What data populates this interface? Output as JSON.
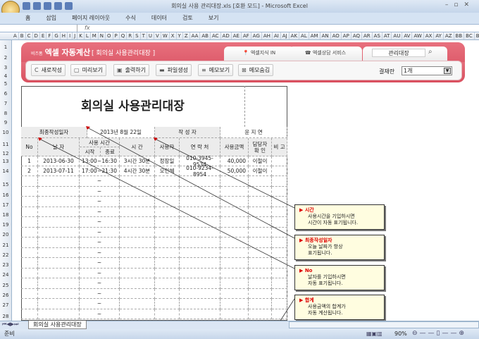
{
  "window": {
    "title": "회의실 사용 관리대장.xls  [호환 모드] - Microsoft Excel"
  },
  "ribbon_tabs": [
    "홈",
    "삽입",
    "페이지 레이아웃",
    "수식",
    "데이터",
    "검토",
    "보기"
  ],
  "columns": [
    "A",
    "B",
    "C",
    "D",
    "E",
    "F",
    "G",
    "H",
    "I",
    "J",
    "K",
    "L",
    "M",
    "N",
    "O",
    "P",
    "Q",
    "R",
    "S",
    "T",
    "U",
    "V",
    "W",
    "X",
    "Y",
    "Z",
    "AA",
    "AB",
    "AC",
    "AD",
    "AE",
    "AF",
    "AG",
    "AH",
    "AI",
    "AJ",
    "AK",
    "AL",
    "AM",
    "AN",
    "AO",
    "AP",
    "AQ",
    "AR",
    "AS",
    "AT",
    "AU",
    "AV",
    "AW",
    "AX",
    "AY",
    "AZ",
    "BB",
    "BC",
    "BD"
  ],
  "banner": {
    "brand_small": "비즈폼",
    "brand": "엑셀 자동계산",
    "subtitle": "[ 회의실 사용관리대장 ]",
    "tab1": "엑셀지식 IN",
    "tab2": "엑셀상담 서비스",
    "search": "관리대장"
  },
  "toolbar": {
    "buttons": [
      "새로작성",
      "미리보기",
      "출력하기",
      "파일생성",
      "메모보기",
      "메모숨김"
    ],
    "approval_label": "결재란",
    "approval_value": "1개"
  },
  "sheet": {
    "title": "회의실 사용관리대장",
    "last_date_label": "최종작성일자",
    "last_date": "2013년 8월 22일",
    "author_label": "작 성 자",
    "author": "윤 지 연",
    "headers": {
      "no": "No",
      "date": "날   자",
      "usage_time": "사용 시간",
      "start": "시작",
      "end": "종료",
      "duration": "시   간",
      "user": "사용자",
      "contact": "연 락 처",
      "amount": "사용금액",
      "manager": "담당자\n확  인",
      "note": "비 고"
    },
    "rows": [
      {
        "no": "1",
        "date": "2013-06-30",
        "start": "13:00",
        "sep": "~",
        "end": "16:30",
        "duration": "3시간 30분",
        "user": "정장일",
        "contact": "010-3945-9534",
        "amount": "40,000",
        "manager": "이철이"
      },
      {
        "no": "2",
        "date": "2013-07-11",
        "start": "17:00",
        "sep": "~",
        "end": "21:30",
        "duration": "4시간 30분",
        "user": "오인혜",
        "contact": "010-9234-8954",
        "amount": "50,000",
        "manager": "이철이"
      }
    ],
    "empty_sep": "~"
  },
  "notes": [
    {
      "title": "시간",
      "text1": "사용시간을 기입하시면",
      "text2": "시간이 자동 표기됩니다."
    },
    {
      "title": "최종작성일자",
      "text1": "오늘 날짜가 항상",
      "text2": "표기됩니다."
    },
    {
      "title": "No",
      "text1": "날자를 기입하시면",
      "text2": "자동 표기됩니다."
    },
    {
      "title": "합계",
      "text1": "사용금액의 합계가",
      "text2": "자동 계산됩니다."
    }
  ],
  "sheet_tab": "회의실 사용관리대장",
  "status": {
    "ready": "준비",
    "zoom": "90%"
  }
}
